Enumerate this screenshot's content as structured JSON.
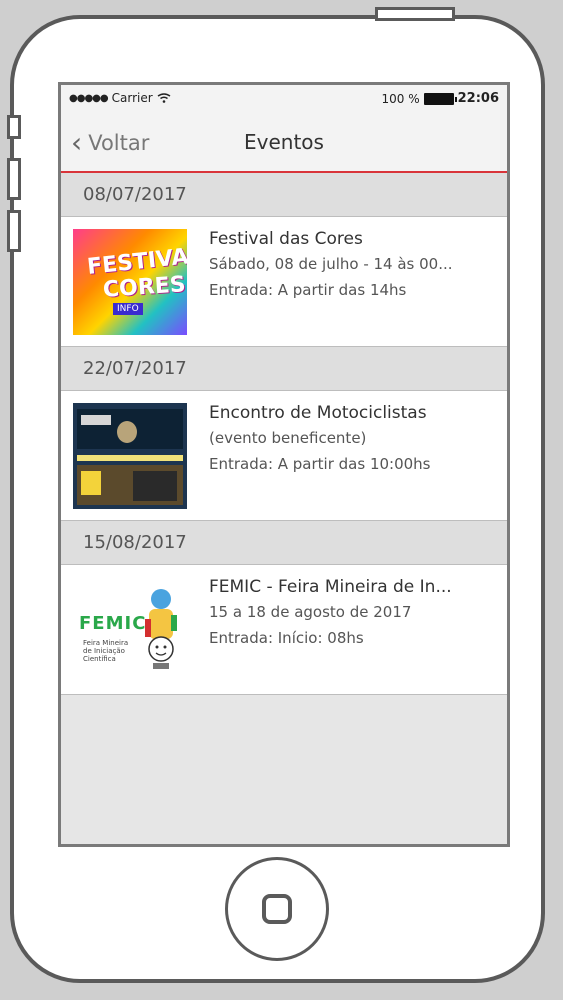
{
  "status_bar": {
    "signal": "●●●●●",
    "carrier": "Carrier",
    "battery": "100 %",
    "time": "22:06"
  },
  "nav": {
    "back_label": "Voltar",
    "title": "Eventos"
  },
  "events": [
    {
      "date": "08/07/2017",
      "title": "Festival das Cores",
      "line1": "Sábado, 08 de julho - 14 às 00...",
      "line2": "Entrada: A partir das 14hs",
      "thumb": {
        "text1": "FESTIVAL",
        "text2": "CORES",
        "text3": "INFO"
      }
    },
    {
      "date": "22/07/2017",
      "title": "Encontro de Motociclistas",
      "line1": "(evento beneficente)",
      "line2": "Entrada: A partir das 10:00hs"
    },
    {
      "date": "15/08/2017",
      "title": "FEMIC - Feira Mineira de In...",
      "line1": "15 a 18 de agosto de 2017",
      "line2": "Entrada: Início: 08hs",
      "thumb": {
        "logo": "FEMIC",
        "caption": "Feira Mineira de Iniciação Científica"
      }
    }
  ]
}
